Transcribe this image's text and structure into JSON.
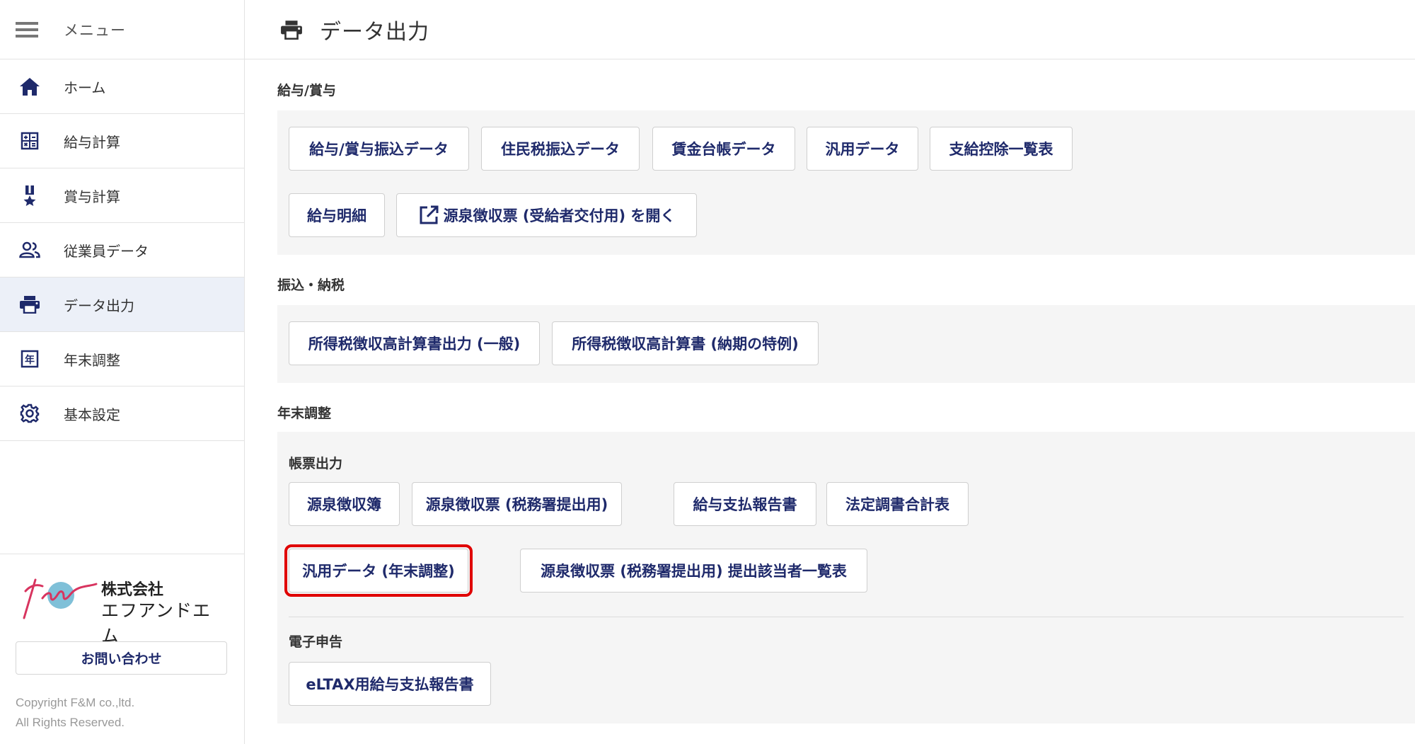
{
  "sidebar": {
    "menu_label": "メニュー",
    "items": [
      {
        "label": "ホーム",
        "icon": "home-icon"
      },
      {
        "label": "給与計算",
        "icon": "calculator-icon"
      },
      {
        "label": "賞与計算",
        "icon": "medal-icon"
      },
      {
        "label": "従業員データ",
        "icon": "people-icon"
      },
      {
        "label": "データ出力",
        "icon": "printer-icon",
        "active": true
      },
      {
        "label": "年末調整",
        "icon": "year-calendar-icon"
      },
      {
        "label": "基本設定",
        "icon": "gear-icon"
      }
    ],
    "company_line1": "株式会社",
    "company_line2": "エフアンドエム",
    "contact_label": "お問い合わせ",
    "copyright_line1": "Copyright F&M co.,ltd.",
    "copyright_line2": "All Rights Reserved."
  },
  "header": {
    "title": "データ出力",
    "icon": "printer-icon"
  },
  "sections": {
    "salary": {
      "title": "給与/賞与",
      "buttons": [
        "給与/賞与振込データ",
        "住民税振込データ",
        "賃金台帳データ",
        "汎用データ",
        "支給控除一覧表",
        "給与明細",
        "源泉徴収票 (受給者交付用) を開く"
      ]
    },
    "transfer": {
      "title": "振込・納税",
      "buttons": [
        "所得税徴収高計算書出力 (一般)",
        "所得税徴収高計算書 (納期の特例)"
      ]
    },
    "yearend": {
      "title": "年末調整",
      "forms_title": "帳票出力",
      "buttons": [
        "源泉徴収簿",
        "源泉徴収票 (税務署提出用)",
        "給与支払報告書",
        "法定調書合計表",
        "汎用データ (年末調整)",
        "源泉徴収票 (税務署提出用) 提出該当者一覧表"
      ],
      "efile_title": "電子申告",
      "efile_buttons": [
        "eLTAX用給与支払報告書"
      ]
    }
  },
  "colors": {
    "accent": "#1f2a6b",
    "highlight": "#e00000",
    "active_bg": "#ecf0f8",
    "panel_bg": "#f5f5f5"
  }
}
